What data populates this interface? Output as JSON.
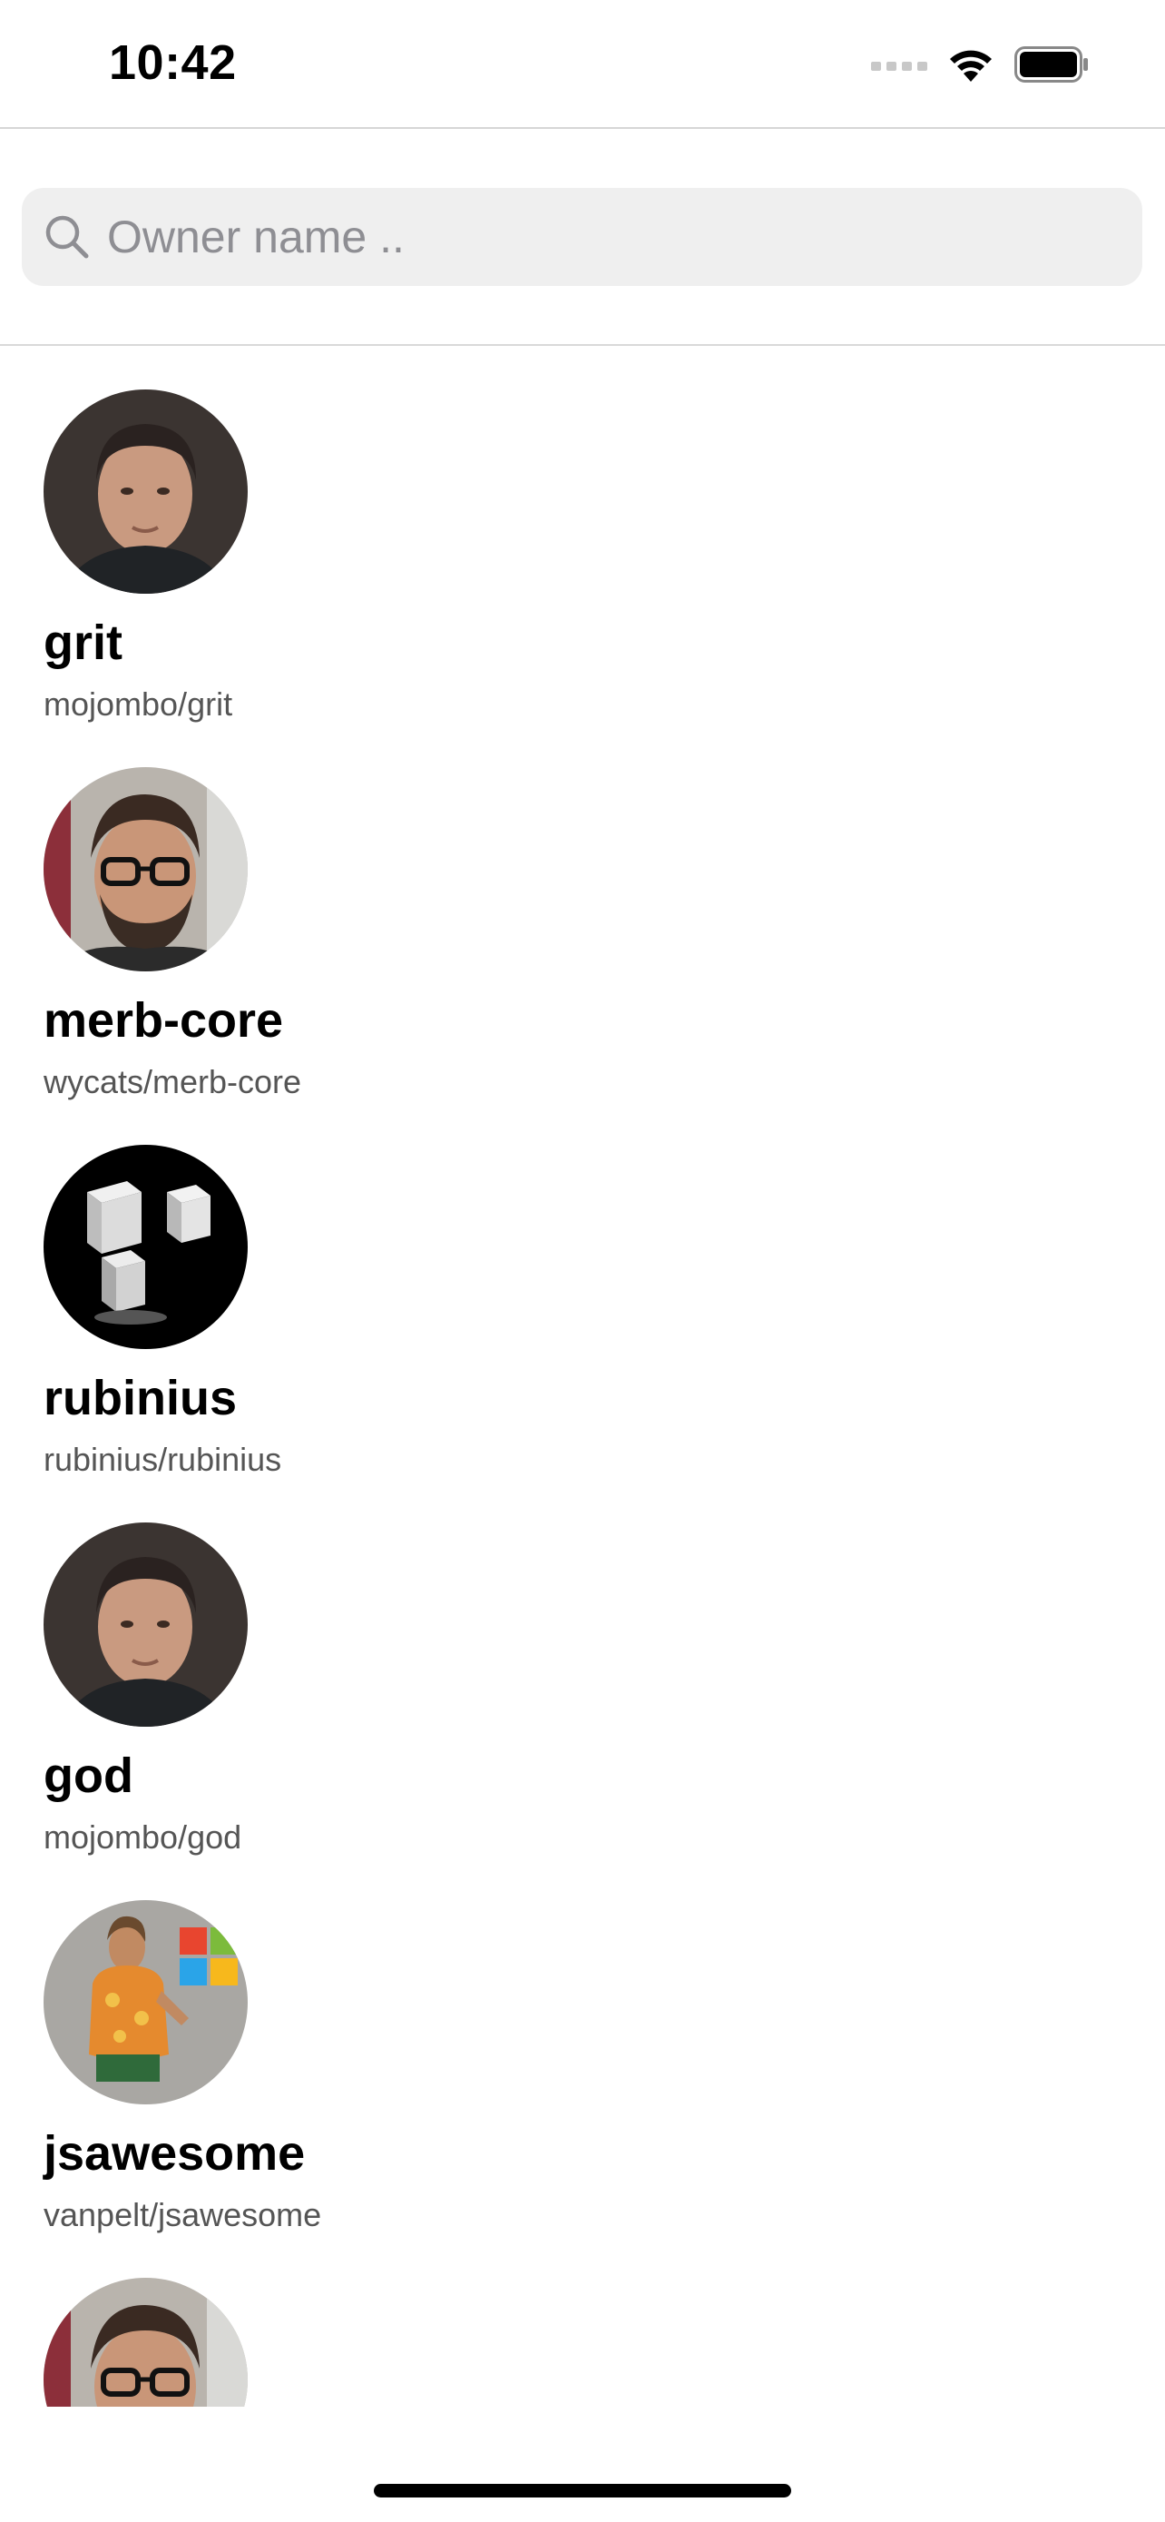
{
  "status_bar": {
    "time": "10:42",
    "icons": [
      "cellular-dots-icon",
      "wifi-icon",
      "battery-icon"
    ]
  },
  "search": {
    "placeholder": "Owner name ..",
    "value": "",
    "icon": "search-icon"
  },
  "repos": [
    {
      "name": "grit",
      "full_name": "mojombo/grit",
      "avatar": "photo-man-dark-hair"
    },
    {
      "name": "merb-core",
      "full_name": "wycats/merb-core",
      "avatar": "photo-man-glasses-beard"
    },
    {
      "name": "rubinius",
      "full_name": "rubinius/rubinius",
      "avatar": "rubinius-logo"
    },
    {
      "name": "god",
      "full_name": "mojombo/god",
      "avatar": "photo-man-dark-hair"
    },
    {
      "name": "jsawesome",
      "full_name": "vanpelt/jsawesome",
      "avatar": "photo-man-orange-shirt"
    },
    {
      "name": "",
      "full_name": "",
      "avatar": "photo-man-glasses-beard"
    }
  ],
  "colors": {
    "search_bg": "#efefef",
    "placeholder": "#8e8e93",
    "subtitle": "#555555"
  }
}
